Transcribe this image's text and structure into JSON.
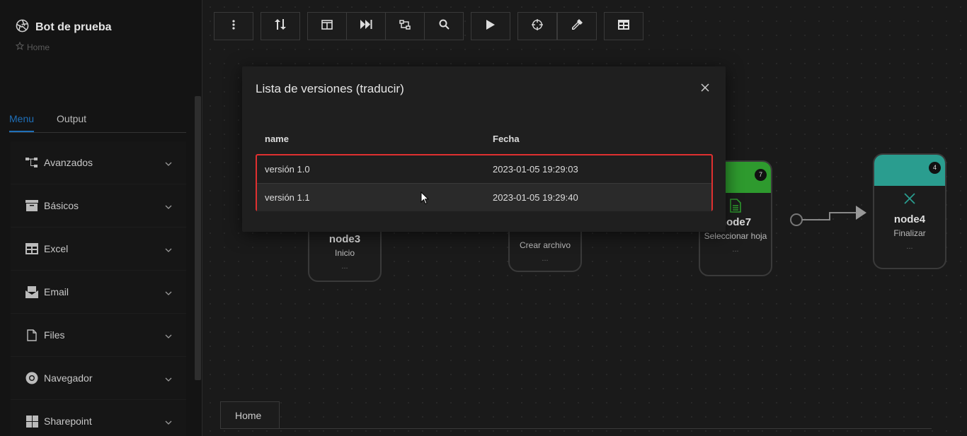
{
  "app": {
    "title": "Bot de prueba",
    "breadcrumb": "Home"
  },
  "sidebar": {
    "tabs": [
      {
        "label": "Menu"
      },
      {
        "label": "Output"
      }
    ],
    "items": [
      {
        "label": "Avanzados",
        "icon": "flow-icon"
      },
      {
        "label": "Básicos",
        "icon": "archive-icon"
      },
      {
        "label": "Excel",
        "icon": "table-icon"
      },
      {
        "label": "Email",
        "icon": "mail-icon"
      },
      {
        "label": "Files",
        "icon": "file-icon"
      },
      {
        "label": "Navegador",
        "icon": "chrome-icon"
      },
      {
        "label": "Sharepoint",
        "icon": "windows-icon"
      }
    ]
  },
  "nodes": [
    {
      "name": "node3",
      "desc": "Inicio",
      "dots": "..."
    },
    {
      "name": "",
      "desc": "Crear archivo",
      "dots": "..."
    },
    {
      "name": "node7",
      "desc": "Seleccionar hoja",
      "dots": "...",
      "badge": "7",
      "color": "#2e9a2e"
    },
    {
      "name": "node4",
      "desc": "Finalizar",
      "dots": "...",
      "badge": "4",
      "color": "#2a9d8f"
    }
  ],
  "bottom_tab": "Home",
  "modal": {
    "title": "Lista de versiones (traducir)",
    "columns": [
      "name",
      "Fecha"
    ],
    "rows": [
      {
        "name": "versión 1.0",
        "date": "2023-01-05 19:29:03"
      },
      {
        "name": "versión 1.1",
        "date": "2023-01-05 19:29:40"
      }
    ]
  },
  "colors": {
    "accent": "#1f6fb8",
    "highlight": "#e03030",
    "green": "#2e9a2e",
    "teal": "#2a9d8f"
  }
}
